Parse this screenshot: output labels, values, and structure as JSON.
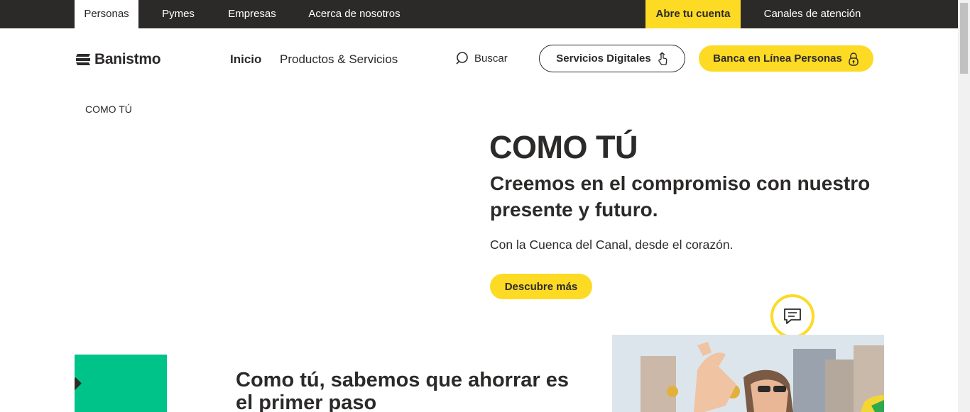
{
  "topbar": {
    "tabs": [
      {
        "label": "Personas",
        "active": true
      },
      {
        "label": "Pymes"
      },
      {
        "label": "Empresas"
      },
      {
        "label": "Acerca de nosotros"
      }
    ],
    "cta": "Abre tu cuenta",
    "channels": "Canales de atención"
  },
  "header": {
    "logo_text": "Banistmo",
    "nav": [
      "Inicio",
      "Productos & Servicios"
    ],
    "search_label": "Buscar",
    "digital_services": "Servicios Digitales",
    "online_banking": "Banca en Línea Personas"
  },
  "hero": {
    "image_alt": "COMO TÚ",
    "title": "COMO TÚ",
    "subtitle": "Creemos en el compromiso con nuestro presente y futuro.",
    "description": "Con la Cuenca del Canal, desde el corazón.",
    "button": "Descubre más"
  },
  "section": {
    "title": "Como tú, sabemos que ahorrar es el primer paso"
  },
  "icons": {
    "logo": "banistmo-logo-icon",
    "search": "search-icon",
    "touch": "touch-hand-icon",
    "lock": "lock-icon",
    "chat": "chat-icon",
    "broken_image": "broken-image-icon"
  },
  "colors": {
    "brand_yellow": "#fdda24",
    "dark": "#2c2a29",
    "green": "#00c389"
  }
}
